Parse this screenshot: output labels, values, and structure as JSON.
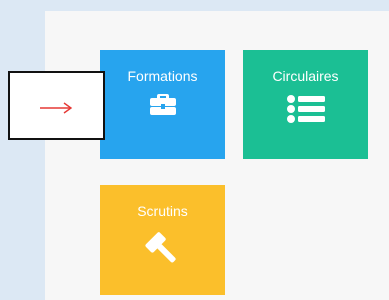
{
  "tiles": [
    {
      "label": "Formations",
      "icon": "briefcase-icon",
      "color": "#27a4ee"
    },
    {
      "label": "Circulaires",
      "icon": "list-icon",
      "color": "#1bbf94"
    },
    {
      "label": "Scrutins",
      "icon": "gavel-icon",
      "color": "#fbbf2b"
    }
  ],
  "annotation": {
    "icon": "red-arrow-icon",
    "color": "#e53935"
  },
  "colors": {
    "page_background": "#dce8f4",
    "panel_background": "#f7f7f7"
  }
}
